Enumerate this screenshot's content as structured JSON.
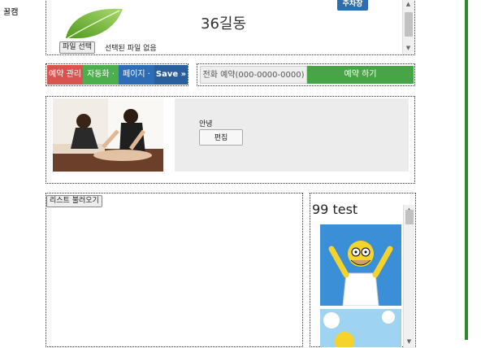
{
  "brand": {
    "name": "꿀캠"
  },
  "header": {
    "title": "36길동",
    "parking_badge": "주차장",
    "file_button": "파일 선택",
    "file_status": "선택된 파일 없음"
  },
  "toolbar": {
    "buttons": [
      {
        "label": "예약 관리",
        "color": "#d9534f"
      },
      {
        "label": "자동화 ·",
        "color": "#4cae4c"
      },
      {
        "label": "페이지 ·",
        "color": "#2d6db5"
      },
      {
        "label": "Save »",
        "color": "#2a5f9e"
      }
    ]
  },
  "reservation": {
    "phone_placeholder": "전화 예약(000-0000-0000)",
    "reserve_button": "예약 하기"
  },
  "profile": {
    "intro_label": "안녕",
    "edit_button": "편집"
  },
  "list": {
    "load_button": "리스트 불러오기"
  },
  "side": {
    "title": "99 test"
  },
  "colors": {
    "accent_green": "#2c8a2c",
    "badge_blue": "#2f6db3",
    "reserve_green": "#47a447"
  }
}
